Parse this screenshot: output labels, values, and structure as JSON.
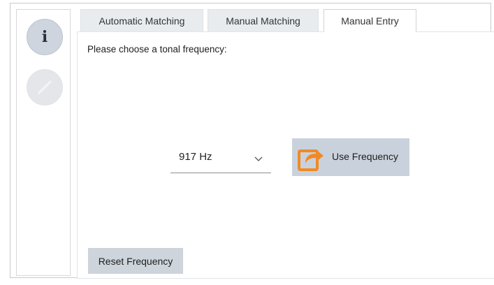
{
  "sidebar": {
    "info_glyph": "i",
    "info_icon": "info-icon",
    "edit_icon": "pencil-icon"
  },
  "tabs": [
    {
      "label": "Automatic Matching",
      "active": false
    },
    {
      "label": "Manual Matching",
      "active": false
    },
    {
      "label": "Manual Entry",
      "active": true
    }
  ],
  "panel": {
    "prompt": "Please choose a tonal frequency:",
    "frequency_select": {
      "selected": "917 Hz",
      "icon": "chevron-down-icon"
    },
    "use_button": {
      "label": "Use Frequency",
      "icon": "share-arrow-icon",
      "icon_color": "#f08a24"
    },
    "reset_button": {
      "label": "Reset Frequency"
    }
  },
  "colors": {
    "button_bg": "#c9d2dc",
    "accent": "#f08a24"
  }
}
